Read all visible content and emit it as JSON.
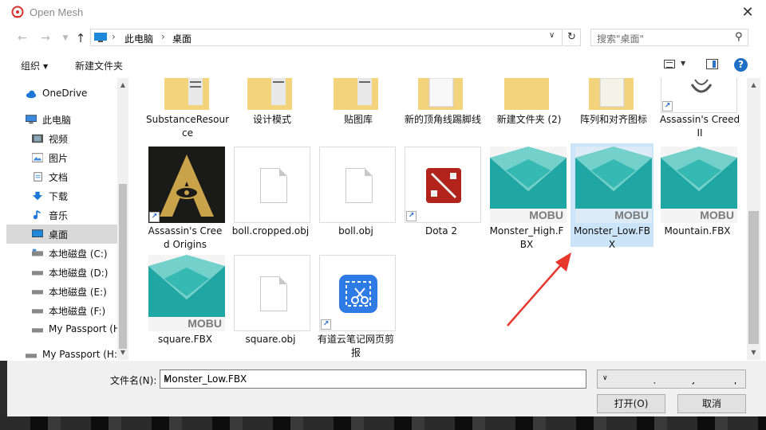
{
  "window": {
    "title": "Open Mesh",
    "close_label": "✕"
  },
  "address": {
    "segments": [
      "此电脑",
      "桌面"
    ],
    "search_placeholder": "搜索\"桌面\""
  },
  "toolbar": {
    "organize": "组织",
    "new_folder": "新建文件夹"
  },
  "sidebar": {
    "items": [
      {
        "label": "OneDrive",
        "icon": "cloud-icon"
      },
      {
        "label": "此电脑",
        "icon": "computer-icon"
      },
      {
        "label": "视频",
        "icon": "video-icon"
      },
      {
        "label": "图片",
        "icon": "pictures-icon"
      },
      {
        "label": "文档",
        "icon": "documents-icon"
      },
      {
        "label": "下载",
        "icon": "download-icon"
      },
      {
        "label": "音乐",
        "icon": "music-icon"
      },
      {
        "label": "桌面",
        "icon": "desktop-icon",
        "selected": true
      },
      {
        "label": "本地磁盘 (C:)",
        "icon": "drive-icon"
      },
      {
        "label": "本地磁盘 (D:)",
        "icon": "drive-icon"
      },
      {
        "label": "本地磁盘 (E:)",
        "icon": "drive-icon"
      },
      {
        "label": "本地磁盘 (F:)",
        "icon": "drive-icon"
      },
      {
        "label": "My Passport (H",
        "icon": "drive-icon"
      },
      {
        "label": "My Passport (H:",
        "icon": "drive-icon"
      }
    ]
  },
  "folders": [
    {
      "name": "SubstanceResource"
    },
    {
      "name": "设计模式"
    },
    {
      "name": "贴图库"
    },
    {
      "name": "新的顶角线踢脚线"
    },
    {
      "name": "新建文件夹 (2)"
    },
    {
      "name": "阵列和对齐图标"
    },
    {
      "name": "Assassin's Creed II",
      "shortcut": true
    }
  ],
  "files_row2": [
    {
      "name": "Assassin's Creed Origins",
      "kind": "ac-origins",
      "shortcut": true
    },
    {
      "name": "boll.cropped.obj",
      "kind": "doc"
    },
    {
      "name": "boll.obj",
      "kind": "doc"
    },
    {
      "name": "Dota 2",
      "kind": "dota",
      "shortcut": true
    },
    {
      "name": "Monster_High.FBX",
      "kind": "mobu"
    },
    {
      "name": "Monster_Low.FBX",
      "kind": "mobu",
      "selected": true
    },
    {
      "name": "Mountain.FBX",
      "kind": "mobu"
    }
  ],
  "files_row3": [
    {
      "name": "square.FBX",
      "kind": "mobu"
    },
    {
      "name": "square.obj",
      "kind": "doc"
    },
    {
      "name": "有道云笔记网页剪报",
      "kind": "youdao",
      "shortcut": true
    }
  ],
  "mobu_word": "MOBU",
  "bottom": {
    "filename_label": "文件名(N):",
    "filename_value": "Monster_Low.FBX",
    "filter_value": "Mesh Files (*.x *.obj *.3ds *.p",
    "open_button": "打开(O)",
    "cancel_button": "取消"
  },
  "colors": {
    "accent": "#1f6fc4",
    "selection": "#cce4f7",
    "folder": "#f3d47c",
    "mobu_teal": "#20a7a4",
    "annotation_arrow": "#e8372d"
  }
}
